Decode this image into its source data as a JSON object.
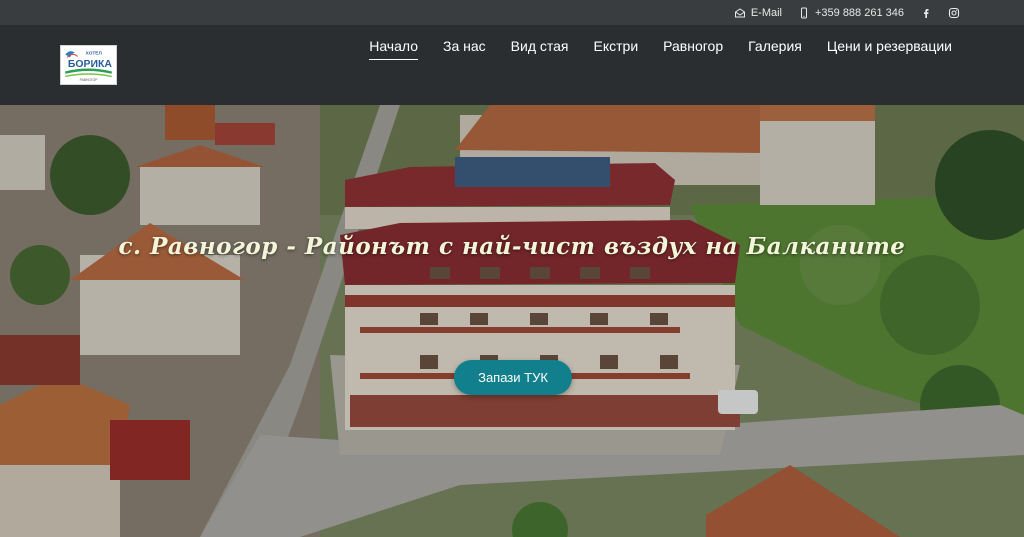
{
  "topbar": {
    "email_label": "E-Mail",
    "email_icon": "envelope-icon",
    "phone_label": "+359 888 261 346",
    "phone_icon": "mobile-phone-icon",
    "social": [
      "facebook-icon",
      "instagram-icon"
    ]
  },
  "logo": {
    "text_main": "БОРИКА",
    "text_top": "ХОТЕЛ",
    "text_bottom": "РАВНОГОР"
  },
  "nav": {
    "items": [
      {
        "label": "Начало",
        "active": true
      },
      {
        "label": "За нас",
        "active": false
      },
      {
        "label": "Вид стая",
        "active": false
      },
      {
        "label": "Екстри",
        "active": false
      },
      {
        "label": "Равногор",
        "active": false
      },
      {
        "label": "Галерия",
        "active": false
      },
      {
        "label": "Цени и резервации",
        "active": false
      }
    ]
  },
  "hero": {
    "title": "с. Равногор - Районът с най-чист въздух на Балканите",
    "cta_label": "Запази ТУК"
  },
  "colors": {
    "header_bg": "#2b2e30",
    "topbar_bg": "#3a3d3f",
    "cta_bg": "#12808c",
    "title_color": "#f3f5d9"
  }
}
